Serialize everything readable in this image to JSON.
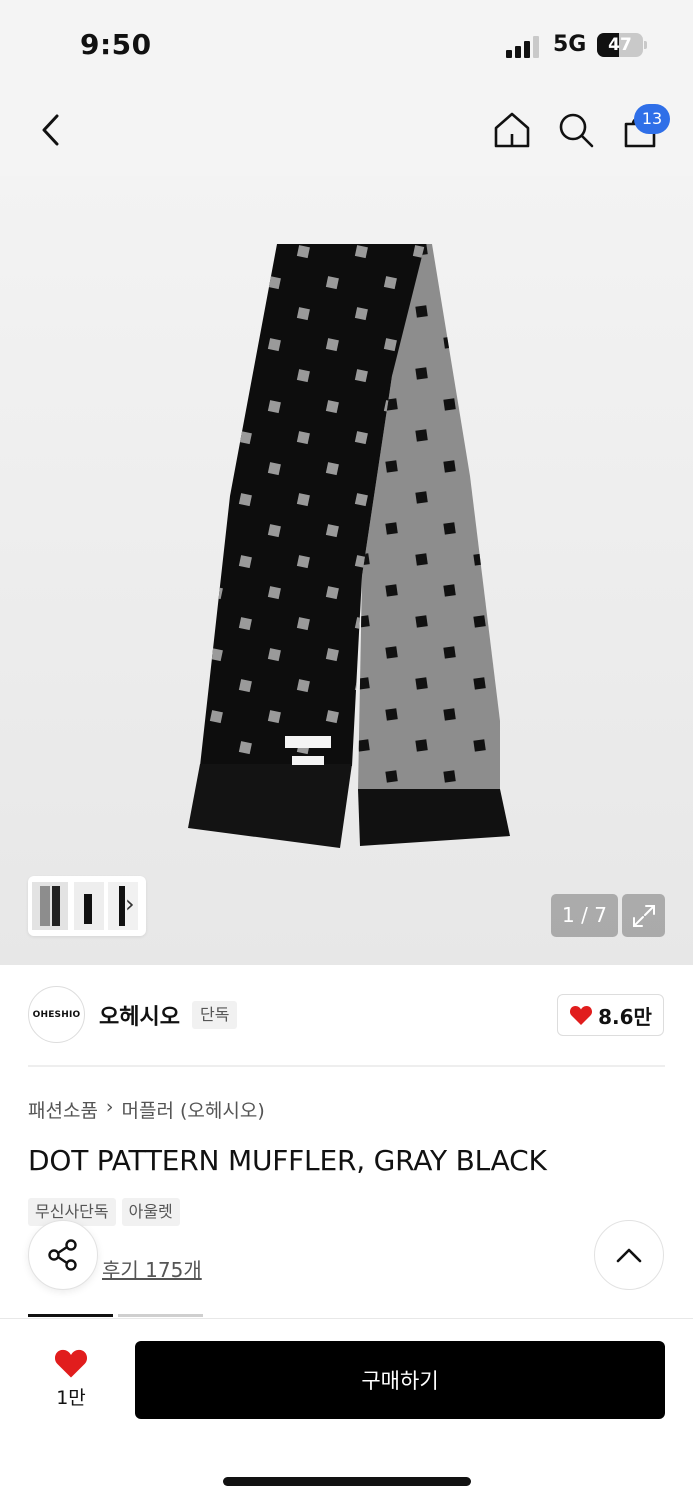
{
  "status_bar": {
    "time": "9:50",
    "network": "5G",
    "battery_level": "47",
    "battery_fraction": 0.47
  },
  "nav": {
    "back_icon": "chevron-left-icon",
    "home_icon": "home-icon",
    "search_icon": "search-icon",
    "cart_icon": "shopping-bag-icon",
    "cart_count": "13"
  },
  "gallery": {
    "counter": "1 / 7",
    "expand_icon": "expand-icon",
    "thumbnail_chevron": "›"
  },
  "brand": {
    "logo_text": "OHESHIO",
    "name": "오헤시오",
    "tag": "단독",
    "likes": "8.6만"
  },
  "product": {
    "breadcrumb": [
      "패션소품",
      "›",
      "머플러 (오헤시오)"
    ],
    "title": "DOT PATTERN MUFFLER, GRAY BLACK",
    "tags": [
      "무신사단독",
      "아울렛"
    ],
    "review_link": "후기 175개"
  },
  "bottom_bar": {
    "like_count": "1만",
    "buy_label": "구매하기"
  },
  "colors": {
    "accent_blue": "#2f6fe8",
    "heart_red": "#e11d1d",
    "buy_button": "#000000"
  }
}
